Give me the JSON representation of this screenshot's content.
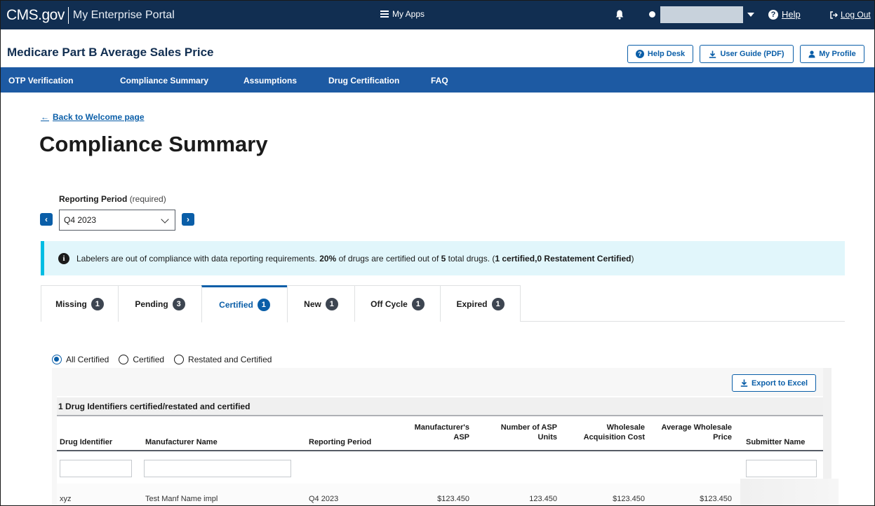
{
  "topbar": {
    "brand_cms": "CMS.gov",
    "brand_portal": "My Enterprise Portal",
    "my_apps": "My Apps",
    "help": "Help",
    "logout": "Log Out"
  },
  "appbar": {
    "title": "Medicare Part B Average Sales Price",
    "help_desk": "Help Desk",
    "user_guide": "User Guide (PDF)",
    "my_profile": "My Profile"
  },
  "nav": {
    "items": [
      "OTP Verification",
      "Compliance Summary",
      "Assumptions",
      "Drug Certification",
      "FAQ"
    ]
  },
  "page": {
    "back_link": "Back to Welcome page",
    "title": "Compliance Summary",
    "reporting_period_label": "Reporting Period",
    "reporting_period_required": "(required)",
    "reporting_period_value": "Q4 2023"
  },
  "alert": {
    "text_1": "Labelers are out of compliance with data reporting requirements. ",
    "pct": "20%",
    "text_2": " of drugs are certified out of ",
    "total": "5",
    "text_3": " total drugs. (",
    "certified_count": "1 certified,",
    "restated_count": "0 Restatement Certified",
    "text_4": ")"
  },
  "tabs": [
    {
      "label": "Missing",
      "count": "1"
    },
    {
      "label": "Pending",
      "count": "3"
    },
    {
      "label": "Certified",
      "count": "1"
    },
    {
      "label": "New",
      "count": "1"
    },
    {
      "label": "Off Cycle",
      "count": "1"
    },
    {
      "label": "Expired",
      "count": "1"
    }
  ],
  "active_tab": "Certified",
  "filters": {
    "options": [
      "All Certified",
      "Certified",
      "Restated and Certified"
    ],
    "selected": "All Certified"
  },
  "table": {
    "export_label": "Export to Excel",
    "caption": "1 Drug Identifiers certified/restated and certified",
    "headers": {
      "drug_identifier": "Drug Identifier",
      "manufacturer_name": "Manufacturer Name",
      "reporting_period": "Reporting Period",
      "manufacturers_asp_1": "Manufacturer's",
      "manufacturers_asp_2": "ASP",
      "asp_units_1": "Number of ASP",
      "asp_units_2": "Units",
      "wac_1": "Wholesale",
      "wac_2": "Acquisition Cost",
      "awp_1": "Average Wholesale",
      "awp_2": "Price",
      "submitter_name": "Submitter Name"
    },
    "rows": [
      {
        "drug_identifier": "xyz",
        "manufacturer_name": "Test Manf Name impl",
        "reporting_period": "Q4 2023",
        "manufacturers_asp": "$123.450",
        "asp_units": "123.450",
        "wac": "$123.450",
        "awp": "$123.450"
      }
    ]
  },
  "colors": {
    "topbar": "#112e51",
    "nav": "#1d5aa3",
    "primary": "#0a5ea8",
    "alert_bg": "#e1f6fb",
    "alert_border": "#00bde3"
  }
}
